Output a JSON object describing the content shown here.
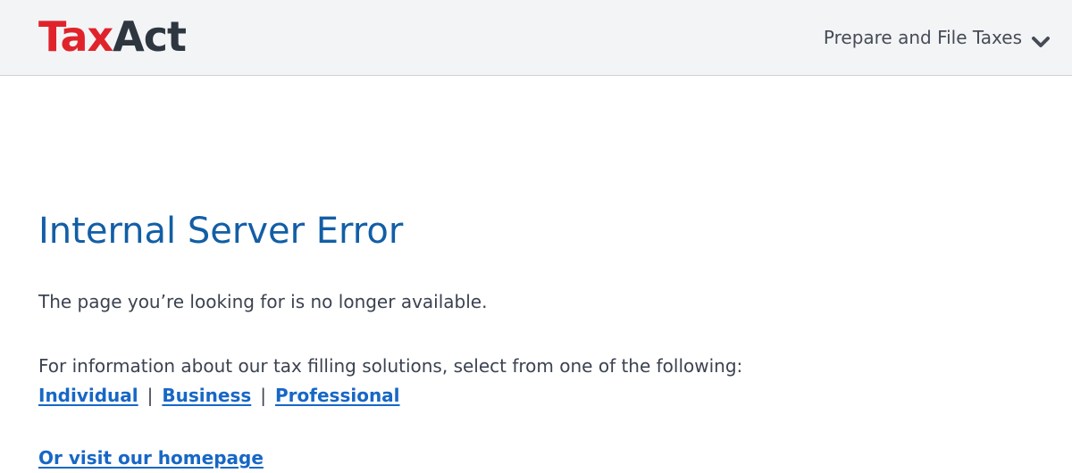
{
  "header": {
    "logo": {
      "part1": "Tax",
      "part2": "Act"
    },
    "nav_label": "Prepare and File Taxes",
    "nav_icon": "chevron-down-icon"
  },
  "main": {
    "title": "Internal Server Error",
    "message": "The page you’re looking for is no longer available.",
    "info": "For information about our tax filling solutions, select from one of the following:",
    "links": [
      {
        "label": "Individual"
      },
      {
        "label": "Business"
      },
      {
        "label": "Professional"
      }
    ],
    "separator": "|",
    "homepage_link": "Or visit our homepage"
  },
  "colors": {
    "brand_red": "#e0232b",
    "brand_dark": "#2e3640",
    "title_blue": "#125ea6",
    "link_blue": "#1767c6",
    "header_bg": "#f3f4f6"
  }
}
